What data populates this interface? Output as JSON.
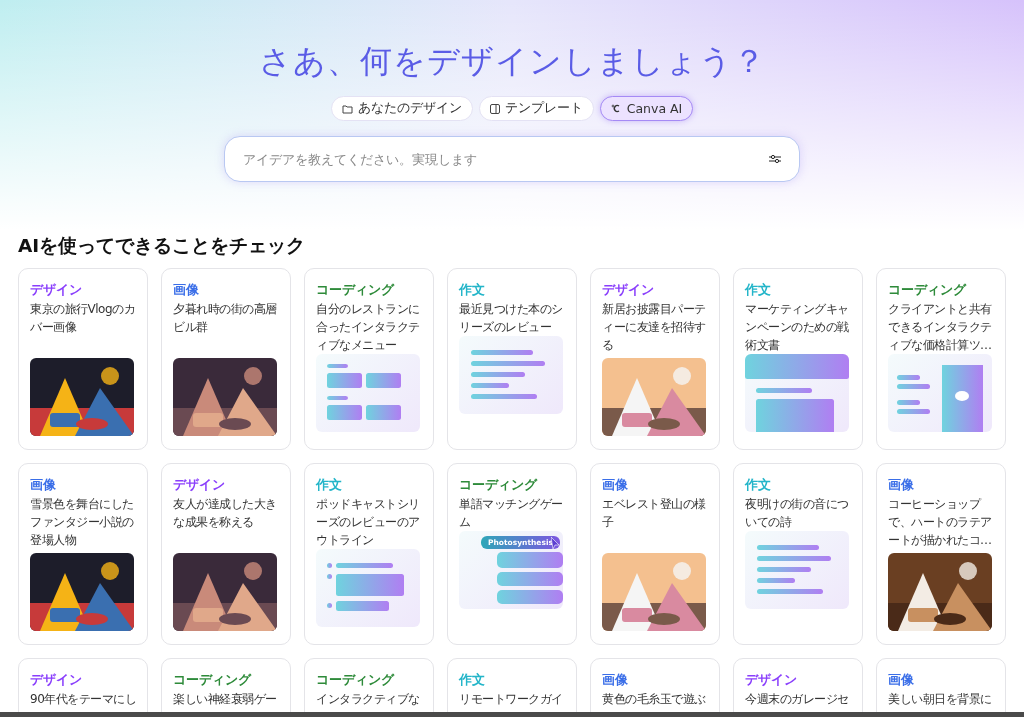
{
  "hero": {
    "title": "さあ、何をデザインしましょう？"
  },
  "tabs": [
    {
      "label": "あなたのデザイン",
      "selected": false
    },
    {
      "label": "テンプレート",
      "selected": false
    },
    {
      "label": "Canva AI",
      "selected": true
    }
  ],
  "search": {
    "placeholder": "アイデアを教えてください。実現します"
  },
  "section": {
    "title": "AIを使ってできることをチェック"
  },
  "cards": [
    {
      "category": "デザイン",
      "kind": "design",
      "text": "東京の旅行Vlogのカバー画像"
    },
    {
      "category": "画像",
      "text": "夕暮れ時の街の高層ビル群"
    },
    {
      "category": "コーディング",
      "kind": "coding",
      "text": "自分のレストランに合ったインタラクティブなメニュー",
      "thumb": {
        "kind": "menu"
      }
    },
    {
      "category": "作文",
      "kind": "writing",
      "text": "最近見つけた本のシリーズのレビュー",
      "thumb": {
        "kind": "lines"
      }
    },
    {
      "category": "デザイン",
      "kind": "design",
      "text": "新居お披露目パーティーに友達を招待する"
    },
    {
      "category": "作文",
      "kind": "writing",
      "text": "マーケティングキャンペーンのための戦術文書",
      "thumb": {
        "kind": "doc"
      }
    },
    {
      "category": "コーディング",
      "kind": "coding",
      "text": "クライアントと共有できるインタラクティブな価格計算ツ…",
      "thumb": {
        "kind": "pricing"
      }
    },
    {
      "category": "画像",
      "text": "雪景色を舞台にしたファンタジー小説の登場人物"
    },
    {
      "category": "デザイン",
      "kind": "design",
      "text": "友人が達成した大きな成果を称える"
    },
    {
      "category": "作文",
      "kind": "writing",
      "text": "ポッドキャストシリーズのレビューのアウトライン",
      "thumb": {
        "kind": "outline"
      }
    },
    {
      "category": "コーディング",
      "kind": "coding",
      "text": "単語マッチングゲーム",
      "thumb": {
        "kind": "quiz",
        "label": "Photosynthesis"
      }
    },
    {
      "category": "画像",
      "text": "エベレスト登山の様子"
    },
    {
      "category": "作文",
      "kind": "writing",
      "text": "夜明けの街の音についての詩",
      "thumb": {
        "kind": "lines"
      }
    },
    {
      "category": "画像",
      "text": "コーヒーショップで、ハートのラテアートが描かれたコ…"
    },
    {
      "category": "デザイン",
      "kind": "design",
      "text": "90年代をテーマにし"
    },
    {
      "category": "コーディング",
      "kind": "coding",
      "text": "楽しい神経衰弱ゲー"
    },
    {
      "category": "コーディング",
      "kind": "coding",
      "text": "インタラクティブな"
    },
    {
      "category": "作文",
      "kind": "writing",
      "text": "リモートワークガイ"
    },
    {
      "category": "画像",
      "text": "黄色の毛糸玉で遊ぶ"
    },
    {
      "category": "デザイン",
      "kind": "design",
      "text": "今週末のガレージセ"
    },
    {
      "category": "画像",
      "text": "美しい朝日を背景に"
    }
  ]
}
